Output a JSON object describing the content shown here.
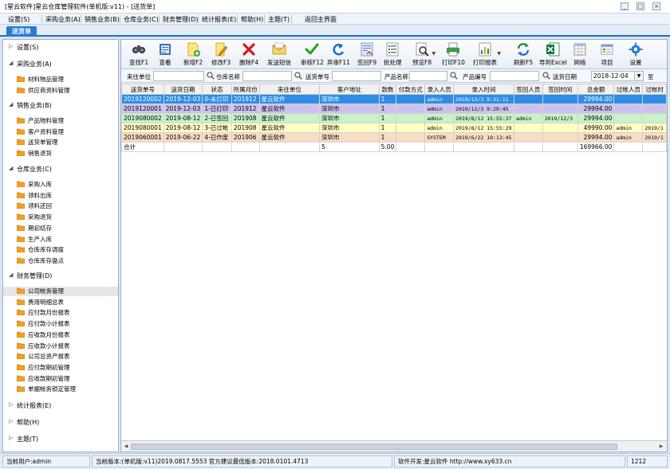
{
  "window": {
    "title": "[星云软件]星云仓库管理软件(单机版:v11) - [送货单]",
    "controls": [
      "_",
      "□",
      "×"
    ]
  },
  "menu": [
    "设置(S)",
    "采购业务(A)",
    "销售业务(B)",
    "仓库业务(C)",
    "财务管理(D)",
    "统计报表(E)",
    "帮助(H)",
    "主题(T)",
    "返回主界面"
  ],
  "tab": "送货单",
  "sidebar": {
    "groups": [
      {
        "label": "设置(S)",
        "expanded": false,
        "items": []
      },
      {
        "label": "采购业务(A)",
        "expanded": true,
        "items": [
          "材料物品管理",
          "供应商资料管理"
        ]
      },
      {
        "label": "销售业务(B)",
        "expanded": true,
        "items": [
          "产品物料管理",
          "客户资料管理",
          "送货单管理",
          "销售退货"
        ]
      },
      {
        "label": "仓库业务(C)",
        "expanded": true,
        "items": [
          "采购入库",
          "领料出库",
          "领料还回",
          "采购退货",
          "期初结存",
          "生产入库",
          "仓库库存调拨",
          "仓库库存盘点"
        ]
      },
      {
        "label": "财务管理(D)",
        "expanded": true,
        "items": [
          "公司帐务管理",
          "费用明细总表",
          "应付款月份报表",
          "应付款小计报表",
          "应收款月份报表",
          "应收款小计报表",
          "公司总资产报表",
          "应付款期初管理",
          "应收款期初管理",
          "单据帐务锁定管理"
        ]
      },
      {
        "label": "统计报表(E)",
        "expanded": false,
        "items": []
      },
      {
        "label": "帮助(H)",
        "expanded": false,
        "items": []
      },
      {
        "label": "主题(T)",
        "expanded": false,
        "items": []
      }
    ],
    "selected": "公司帐务管理"
  },
  "toolbar": [
    {
      "label": "查找F1",
      "icon": "binoculars-icon"
    },
    {
      "label": "查看",
      "icon": "view-icon"
    },
    {
      "label": "新增F2",
      "icon": "new-document-icon"
    },
    {
      "label": "修改F3",
      "icon": "edit-icon"
    },
    {
      "label": "删除F4",
      "icon": "delete-icon"
    },
    {
      "label": "发送短信",
      "icon": "sms-icon"
    },
    {
      "label": "审核F12",
      "icon": "check-icon"
    },
    {
      "label": "弃审F11",
      "icon": "undo-icon"
    },
    {
      "label": "签回F9",
      "icon": "sign-back-icon"
    },
    {
      "label": "批处理",
      "icon": "batch-icon"
    },
    {
      "label": "预览F8",
      "icon": "preview-icon"
    },
    {
      "label": "打印F10",
      "icon": "print-icon"
    },
    {
      "label": "打印报表",
      "icon": "report-icon"
    },
    {
      "label": "刷新F5",
      "icon": "refresh-icon"
    },
    {
      "label": "导到Excel",
      "icon": "excel-icon"
    },
    {
      "label": "网格",
      "icon": "grid-icon"
    },
    {
      "label": "项目",
      "icon": "project-icon"
    },
    {
      "label": "设置",
      "icon": "settings-gear-icon"
    }
  ],
  "filters": {
    "labels": [
      "来往单位",
      "仓库名称",
      "送货单号",
      "产品名称",
      "产品编号",
      "送货日期",
      "至"
    ],
    "date_value": "2018-12-04"
  },
  "table": {
    "columns": [
      "送货单号",
      "送货日期",
      "状态",
      "所属月份",
      "来往单位",
      "客户地址",
      "款数",
      "付款方式",
      "录入人员",
      "录入时间",
      "签回人员",
      "签回时间",
      "总金额",
      "过帐人员",
      "过帐时"
    ],
    "rows": [
      {
        "style": "sel",
        "cells": [
          "2019120002",
          "2019-12-03",
          "0-未打印",
          "201912",
          "星云软件",
          "深圳市",
          "1",
          "",
          "admin",
          "2019/12/3 9:31:11",
          "",
          "",
          "29994.00",
          "",
          ""
        ]
      },
      {
        "style": "purple",
        "cells": [
          "2019120001",
          "2019-12-03",
          "1-已打印",
          "201912",
          "星云软件",
          "深圳市",
          "1",
          "",
          "admin",
          "2019/12/3 9:29:45",
          "",
          "",
          "29994.00",
          "",
          ""
        ]
      },
      {
        "style": "green",
        "cells": [
          "2019080002",
          "2019-08-12",
          "2-已签回",
          "201908",
          "星云软件",
          "深圳市",
          "1",
          "",
          "admin",
          "2019/8/12 15:55:37",
          "admin",
          "2019/12/3",
          "29994.00",
          "",
          ""
        ]
      },
      {
        "style": "yellow",
        "cells": [
          "2019080001",
          "2019-08-12",
          "3-已过帐",
          "201908",
          "星云软件",
          "深圳市",
          "1",
          "",
          "admin",
          "2019/8/12 15:55:29",
          "",
          "",
          "49990.00",
          "admin",
          "2019/1"
        ]
      },
      {
        "style": "peach",
        "cells": [
          "2019060001",
          "2019-06-22",
          "4-已作废",
          "201906",
          "星云软件",
          "深圳市",
          "1",
          "",
          "SYSTEM",
          "2019/6/22 10:13:45",
          "",
          "",
          "29994.00",
          "admin",
          "2019/1"
        ]
      },
      {
        "style": "total",
        "cells": [
          "合计",
          "",
          "",
          "",
          "",
          "5",
          "5.00",
          "",
          "",
          "",
          "",
          "",
          "169966.00",
          "",
          ""
        ]
      }
    ]
  },
  "status": {
    "user": "当前用户:admin",
    "version": "当前版本:(单机版:v11)2019.0817.5553 官方建议最低版本:2018.0101.4713",
    "developer": "软件开发:星云软件 http://www.xy633.cn",
    "code": "1212"
  }
}
